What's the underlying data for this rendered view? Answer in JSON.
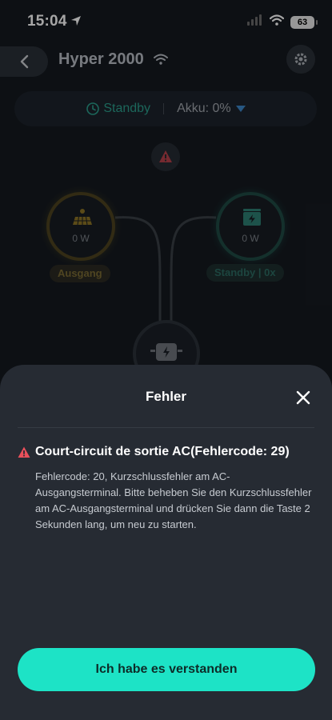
{
  "status_bar": {
    "time": "15:04",
    "battery": "63",
    "icons": [
      "location-arrow-icon",
      "cellular-signal-icon",
      "wifi-icon",
      "battery-icon"
    ]
  },
  "header": {
    "title": "Hyper 2000",
    "icons": [
      "back-chevron-icon",
      "wifi-icon",
      "gear-icon"
    ]
  },
  "state": {
    "mode": "Standby",
    "battery_label": "Akku: 0%"
  },
  "nodes": {
    "solar": {
      "value": "0 W",
      "tag": "Ausgang",
      "icon": "solar-panel-icon"
    },
    "battery": {
      "value": "0 W",
      "tag": "Standby | 0x",
      "icon": "battery-bolt-icon"
    },
    "hub": {
      "icon": "inverter-plug-icon"
    }
  },
  "dialog": {
    "title": "Fehler",
    "error_title": "Court-circuit de sortie AC(Fehlercode: 29)",
    "error_text": "Fehlercode: 20, Kurzschlussfehler am AC-Ausgangsterminal. Bitte beheben Sie den Kurzschlussfehler am AC-Ausgangsterminal und drücken Sie dann die Taste 2 Sekunden lang, um neu zu starten.",
    "confirm_label": "Ich habe es verstanden"
  },
  "colors": {
    "accent": "#1de3c6",
    "warning": "#e8505b",
    "standby": "#2b9e8c",
    "solar_ring": "#4d4320",
    "sheet": "#262b33"
  }
}
